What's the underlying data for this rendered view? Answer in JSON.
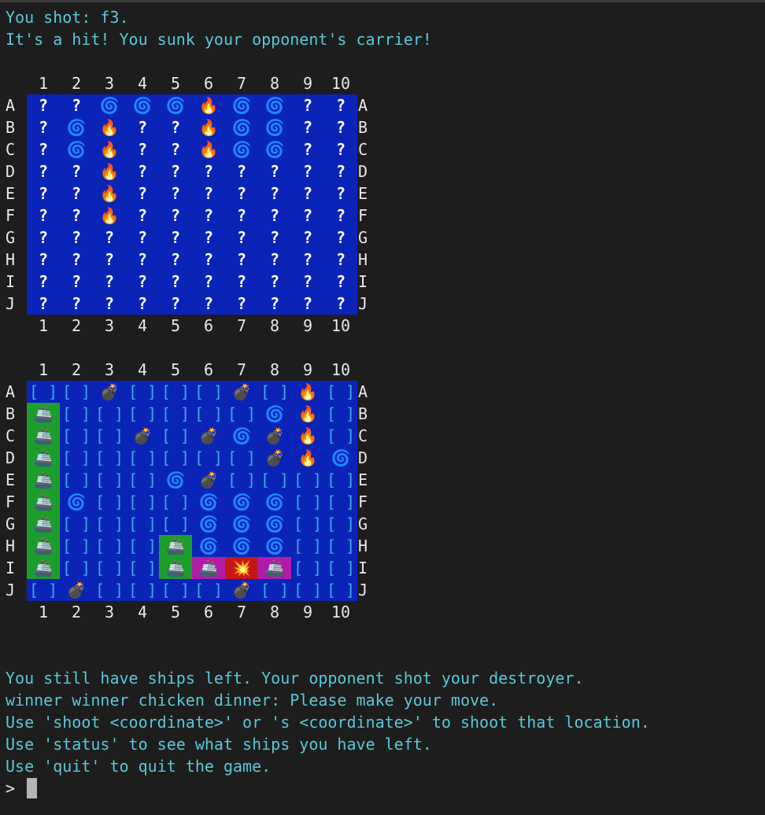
{
  "messages": {
    "shot": "You shot: f3.",
    "result": "It's a hit! You sunk your opponent's carrier!"
  },
  "columns": [
    "1",
    "2",
    "3",
    "4",
    "5",
    "6",
    "7",
    "8",
    "9",
    "10"
  ],
  "rows": [
    "A",
    "B",
    "C",
    "D",
    "E",
    "F",
    "G",
    "H",
    "I",
    "J"
  ],
  "opponent_board": [
    [
      "?",
      "?",
      "@",
      "@",
      "@",
      "*",
      "@",
      "@",
      "?",
      "?"
    ],
    [
      "?",
      "@",
      "*",
      "?",
      "?",
      "*",
      "@",
      "@",
      "?",
      "?"
    ],
    [
      "?",
      "@",
      "*",
      "?",
      "?",
      "*",
      "@",
      "@",
      "?",
      "?"
    ],
    [
      "?",
      "?",
      "*",
      "?",
      "?",
      "?",
      "?",
      "?",
      "?",
      "?"
    ],
    [
      "?",
      "?",
      "*",
      "?",
      "?",
      "?",
      "?",
      "?",
      "?",
      "?"
    ],
    [
      "?",
      "?",
      "*",
      "?",
      "?",
      "?",
      "?",
      "?",
      "?",
      "?"
    ],
    [
      "?",
      "?",
      "?",
      "?",
      "?",
      "?",
      "?",
      "?",
      "?",
      "?"
    ],
    [
      "?",
      "?",
      "?",
      "?",
      "?",
      "?",
      "?",
      "?",
      "?",
      "?"
    ],
    [
      "?",
      "?",
      "?",
      "?",
      "?",
      "?",
      "?",
      "?",
      "?",
      "?"
    ],
    [
      "?",
      "?",
      "?",
      "?",
      "?",
      "?",
      "?",
      "?",
      "?",
      "?"
    ]
  ],
  "player_board": [
    [
      "[ ]",
      "[ ]",
      "B",
      "[ ]",
      "[ ]",
      "[ ]",
      "B",
      "[ ]",
      "*",
      "[ ]"
    ],
    [
      "S",
      "[ ]",
      "[ ]",
      "[ ]",
      "[ ]",
      "[ ]",
      "[ ]",
      "@",
      "*",
      "[ ]"
    ],
    [
      "S",
      "[ ]",
      "[ ]",
      "B",
      "[ ]",
      "B",
      "@",
      "B",
      "*",
      "[ ]"
    ],
    [
      "S",
      "[ ]",
      "[ ]",
      "[ ]",
      "[ ]",
      "[ ]",
      "[ ]",
      "B",
      "*",
      "@"
    ],
    [
      "S",
      "[ ]",
      "[ ]",
      "[ ]",
      "@",
      "B",
      "[ ]",
      "[ ]",
      "[ ]",
      "[ ]"
    ],
    [
      "S",
      "@",
      "[ ]",
      "[ ]",
      "[ ]",
      "@",
      "@",
      "@",
      "[ ]",
      "[ ]"
    ],
    [
      "S",
      "[ ]",
      "[ ]",
      "[ ]",
      "[ ]",
      "@",
      "@",
      "@",
      "[ ]",
      "[ ]"
    ],
    [
      "S",
      "[ ]",
      "[ ]",
      "[ ]",
      "S",
      "@",
      "@",
      "@",
      "[ ]",
      "[ ]"
    ],
    [
      "S",
      "[ ]",
      "[ ]",
      "[ ]",
      "S",
      "P",
      "X",
      "P",
      "[ ]",
      "[ ]"
    ],
    [
      "[ ]",
      "B",
      "[ ]",
      "[ ]",
      "[ ]",
      "[ ]",
      "B",
      "[ ]",
      "[ ]",
      "[ ]"
    ]
  ],
  "symbols": {
    "?": "?",
    "@": "🌀",
    "*": "🔥",
    "B": "💣",
    "S": "🚢",
    "P": "🚢",
    "X": "💥",
    "[ ]": "[ ]"
  },
  "footer": [
    "You still have ships left. Your opponent shot your destroyer.",
    "winner winner chicken dinner: Please make your move.",
    "Use 'shoot <coordinate>' or 's <coordinate>' to shoot that location.",
    "Use 'status' to see what ships you have left.",
    "Use 'quit' to quit the game."
  ],
  "prompt": ">"
}
